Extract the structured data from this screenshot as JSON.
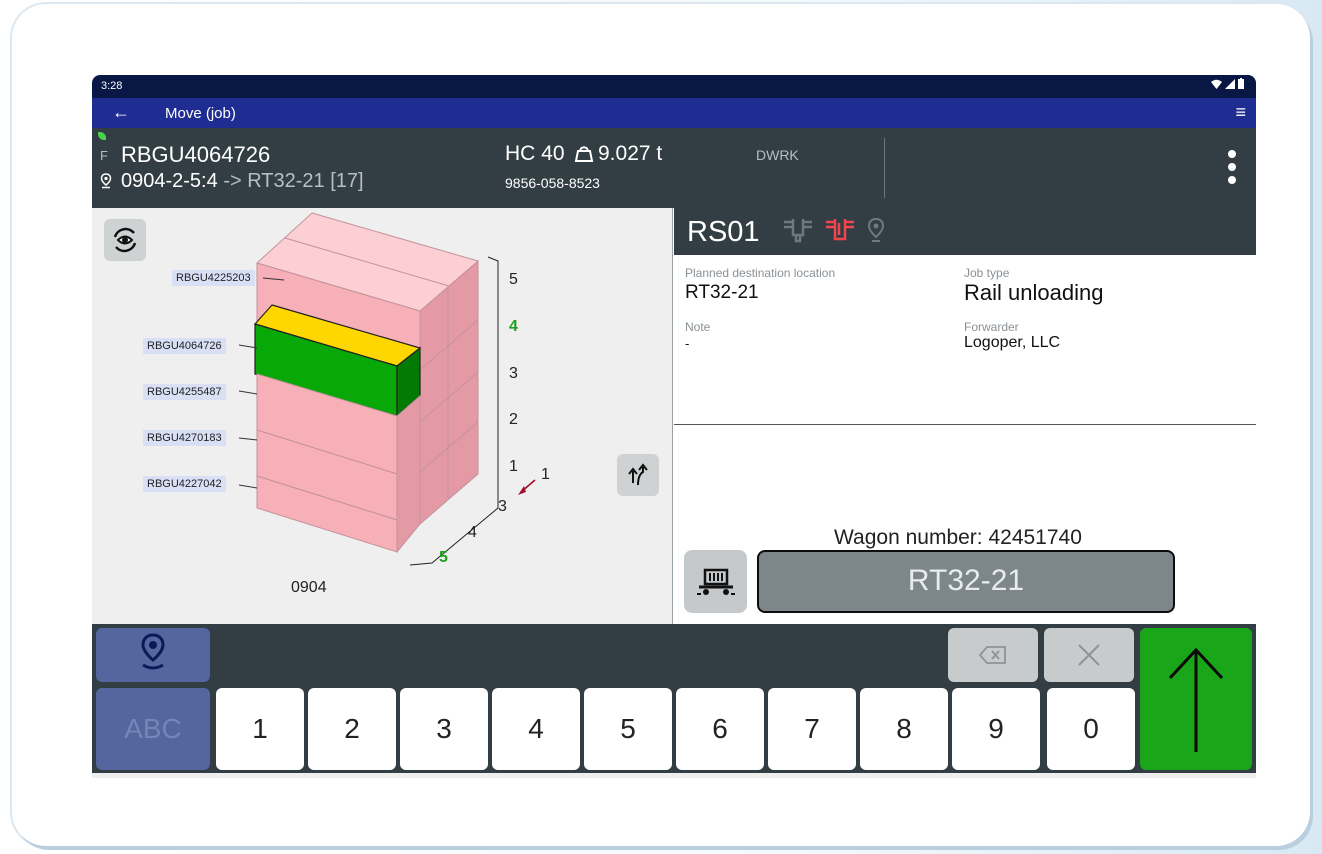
{
  "status_bar": {
    "time": "3:28"
  },
  "app_bar": {
    "title": "Move (job)"
  },
  "info": {
    "status_letter": "F",
    "container_id": "RBGU4064726",
    "from_location": "0904-2-5:4",
    "arrow_text": "->",
    "to_location": "RT32-21 [17]",
    "size_type": "HC 40",
    "weight": "9.027 t",
    "booking": "9856-058-8523",
    "terminal_code": "DWRK"
  },
  "stack": {
    "block_label": "0904",
    "tier_numbers": [
      "1",
      "2",
      "3",
      "4",
      "5"
    ],
    "highlighted_tier": "4",
    "row_numbers": [
      "3",
      "4",
      "5"
    ],
    "highlighted_row": "5",
    "side_number": "1",
    "container_labels": [
      "RBGU4225203",
      "RBGU4064726",
      "RBGU4255487",
      "RBGU4270183",
      "RBGU4227042"
    ],
    "colors": {
      "container": "#f7b0b8",
      "selected_side": "#07a807",
      "selected_top": "#ffd700",
      "highlight_text": "#1ea01e"
    }
  },
  "details": {
    "rs_id": "RS01",
    "planned_destination_label": "Planned destination location",
    "planned_destination": "RT32-21",
    "job_type_label": "Job type",
    "job_type": "Rail unloading",
    "note_label": "Note",
    "note": "-",
    "forwarder_label": "Forwarder",
    "forwarder": "Logoper, LLC",
    "wagon_number": "Wagon number: 42451740",
    "location_input": "RT32-21"
  },
  "keypad": {
    "abc_label": "ABC",
    "digits": [
      "1",
      "2",
      "3",
      "4",
      "5",
      "6",
      "7",
      "8",
      "9",
      "0"
    ],
    "enter_color": "#19a619"
  }
}
